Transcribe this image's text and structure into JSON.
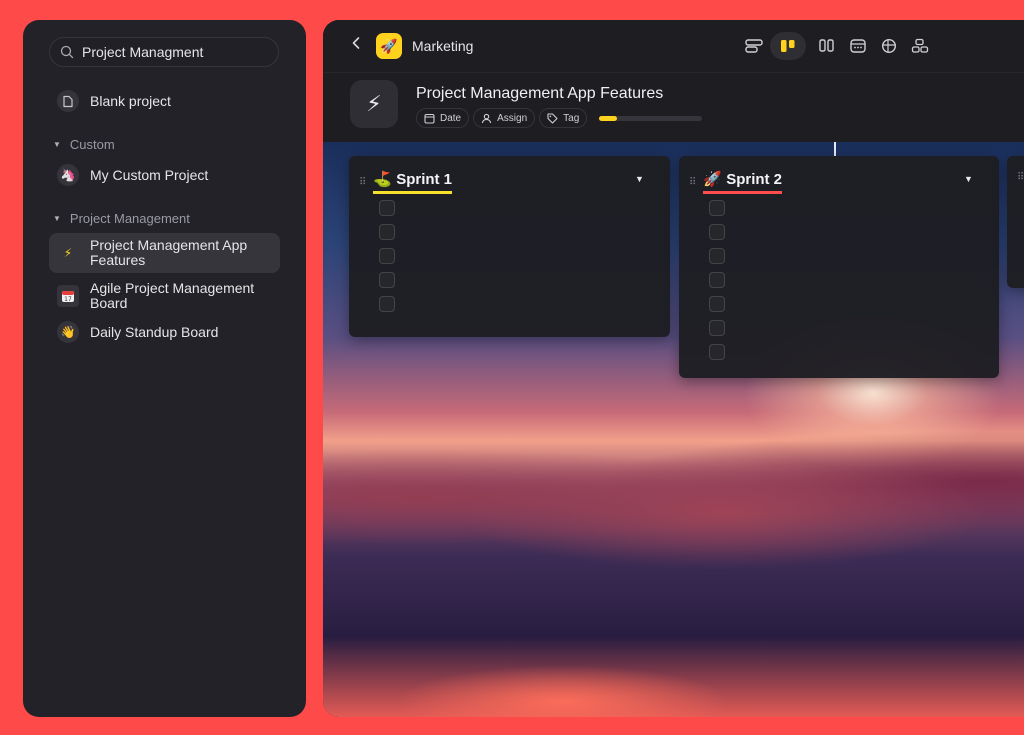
{
  "sidebar": {
    "search": {
      "value": "Project Managment",
      "placeholder": "Search"
    },
    "blank_project": "Blank project",
    "sections": [
      {
        "title": "Custom",
        "items": [
          {
            "label": "My Custom Project",
            "icon": "unicorn-icon"
          }
        ]
      },
      {
        "title": "Project Management",
        "items": [
          {
            "label": "Project Management App Features",
            "icon": "lightning-icon",
            "active": true
          },
          {
            "label": "Agile Project Management Board",
            "icon": "calendar-icon"
          },
          {
            "label": "Daily Standup Board",
            "icon": "wave-hand-icon"
          }
        ]
      }
    ]
  },
  "topbar": {
    "workspace": "Marketing",
    "workspace_icon": "🚀",
    "views": [
      "list-view-icon",
      "board-view-icon",
      "columns-view-icon",
      "calendar-view-icon",
      "table-view-icon",
      "grid-view-icon"
    ],
    "active_view": 1
  },
  "page": {
    "icon": "⚡",
    "title": "Project Management App Features",
    "chips": {
      "date": "Date",
      "assign": "Assign",
      "tag": "Tag"
    },
    "progress": 0.17
  },
  "board": {
    "columns": [
      {
        "emoji": "⛳",
        "title": "Sprint 1",
        "underline": "#f5e12b",
        "checkboxes": 5
      },
      {
        "emoji": "🚀",
        "title": "Sprint 2",
        "underline": "#ff4d4d",
        "checkboxes": 7
      }
    ]
  },
  "colors": {
    "accent_yellow": "#ffd21e",
    "frame_red": "#ff4a4a",
    "panel": "#222228"
  }
}
